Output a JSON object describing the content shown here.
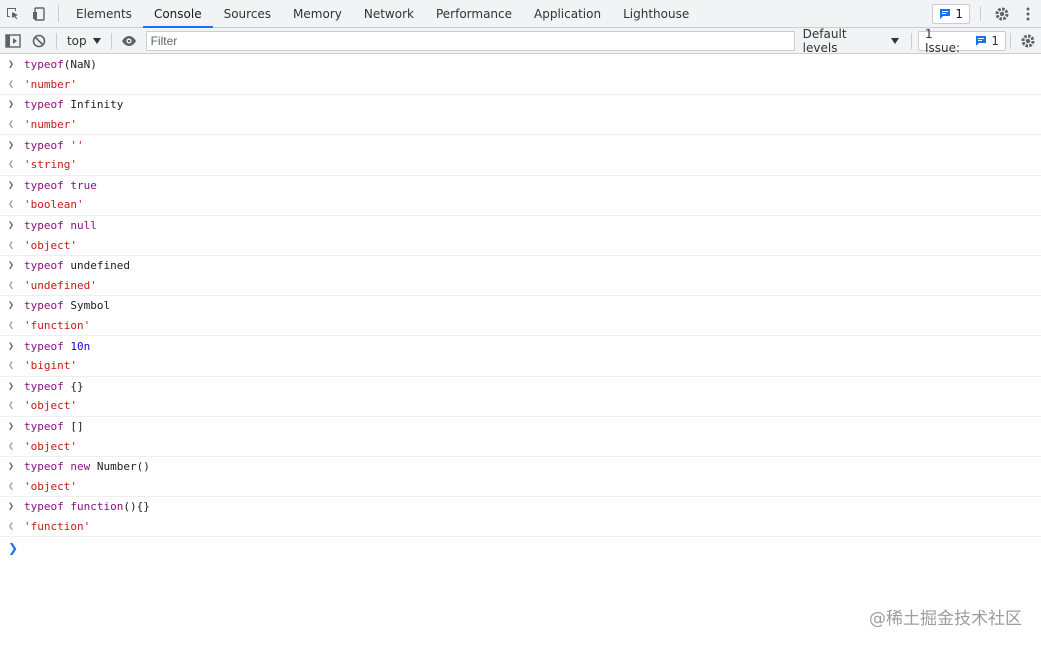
{
  "tabs": [
    "Elements",
    "Console",
    "Sources",
    "Memory",
    "Network",
    "Performance",
    "Application",
    "Lighthouse"
  ],
  "active_tab": "Console",
  "messages_badge": "1",
  "toolbar": {
    "context": "top",
    "filter_placeholder": "Filter",
    "levels": "Default levels",
    "issues_label": "1 Issue:",
    "issues_count": "1"
  },
  "entries": [
    {
      "input": [
        [
          "kw",
          "typeof"
        ],
        [
          "plain",
          "(NaN)"
        ]
      ],
      "output": "'number'"
    },
    {
      "input": [
        [
          "kw",
          "typeof"
        ],
        [
          "plain",
          " Infinity"
        ]
      ],
      "output": "'number'"
    },
    {
      "input": [
        [
          "kw",
          "typeof"
        ],
        [
          "plain",
          " "
        ],
        [
          "str",
          "''"
        ]
      ],
      "output": "'string'"
    },
    {
      "input": [
        [
          "kw",
          "typeof"
        ],
        [
          "plain",
          " "
        ],
        [
          "kw",
          "true"
        ]
      ],
      "output": "'boolean'"
    },
    {
      "input": [
        [
          "kw",
          "typeof"
        ],
        [
          "plain",
          " "
        ],
        [
          "kw",
          "null"
        ]
      ],
      "output": "'object'"
    },
    {
      "input": [
        [
          "kw",
          "typeof"
        ],
        [
          "plain",
          " undefined"
        ]
      ],
      "output": "'undefined'"
    },
    {
      "input": [
        [
          "kw",
          "typeof"
        ],
        [
          "plain",
          " Symbol"
        ]
      ],
      "output": "'function'"
    },
    {
      "input": [
        [
          "kw",
          "typeof"
        ],
        [
          "plain",
          " "
        ],
        [
          "num",
          "10n"
        ]
      ],
      "output": "'bigint'"
    },
    {
      "input": [
        [
          "kw",
          "typeof"
        ],
        [
          "plain",
          " {}"
        ]
      ],
      "output": "'object'"
    },
    {
      "input": [
        [
          "kw",
          "typeof"
        ],
        [
          "plain",
          " []"
        ]
      ],
      "output": "'object'"
    },
    {
      "input": [
        [
          "kw",
          "typeof"
        ],
        [
          "plain",
          " "
        ],
        [
          "kw",
          "new"
        ],
        [
          "plain",
          " Number()"
        ]
      ],
      "output": "'object'"
    },
    {
      "input": [
        [
          "kw",
          "typeof"
        ],
        [
          "plain",
          " "
        ],
        [
          "kw",
          "function"
        ],
        [
          "plain",
          "(){}"
        ]
      ],
      "output": "'function'"
    }
  ],
  "watermark": "@稀土掘金技术社区",
  "colors": {
    "accent": "#1a73e8",
    "keyword": "#881280",
    "string": "#c41a16",
    "number": "#1c00cf"
  }
}
